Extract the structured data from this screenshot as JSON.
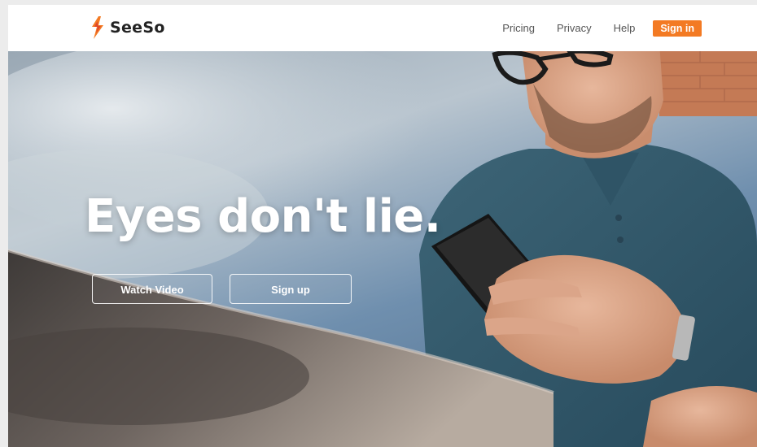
{
  "brand": {
    "name": "SeeSo",
    "logo_icon": "flame-logo-icon",
    "accent_color": "#f37a23"
  },
  "nav": {
    "links": [
      "Pricing",
      "Privacy",
      "Help"
    ],
    "signin_label": "Sign in"
  },
  "hero": {
    "headline": "Eyes don't lie.",
    "buttons": {
      "watch_video": "Watch Video",
      "sign_up": "Sign up"
    },
    "image": "man-holding-smartphone-photo"
  }
}
